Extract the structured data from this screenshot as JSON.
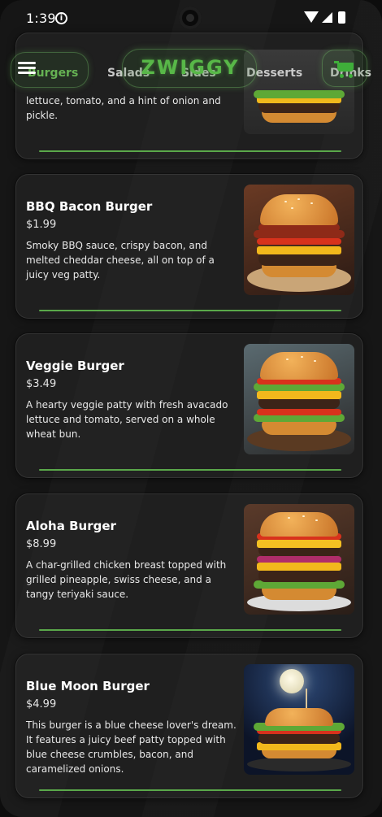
{
  "status_bar": {
    "time": "1:39",
    "info_glyph": "i"
  },
  "header": {
    "logo": "ZWIGGY",
    "tabs": [
      "Burgers",
      "Salads",
      "Sides",
      "Desserts",
      "Drinks"
    ],
    "active_tab": "Burgers",
    "accent_color": "#58b848"
  },
  "items": [
    {
      "name": "",
      "price": "",
      "description": "lettuce, tomato, and a hint of onion and pickle."
    },
    {
      "name": "BBQ Bacon Burger",
      "price": "$1.99",
      "description": "Smoky BBQ sauce, crispy bacon, and melted cheddar cheese, all on top of a juicy veg patty."
    },
    {
      "name": "Veggie Burger",
      "price": "$3.49",
      "description": "A hearty veggie patty with fresh avacado lettuce and tomato, served on a whole wheat bun."
    },
    {
      "name": "Aloha Burger",
      "price": "$8.99",
      "description": "A char-grilled chicken breast topped with grilled pineapple, swiss cheese, and a tangy teriyaki sauce."
    },
    {
      "name": "Blue Moon Burger",
      "price": "$4.99",
      "description": "This burger is a blue cheese lover's dream. It features a juicy beef patty topped with blue cheese crumbles, bacon, and caramelized onions."
    }
  ]
}
